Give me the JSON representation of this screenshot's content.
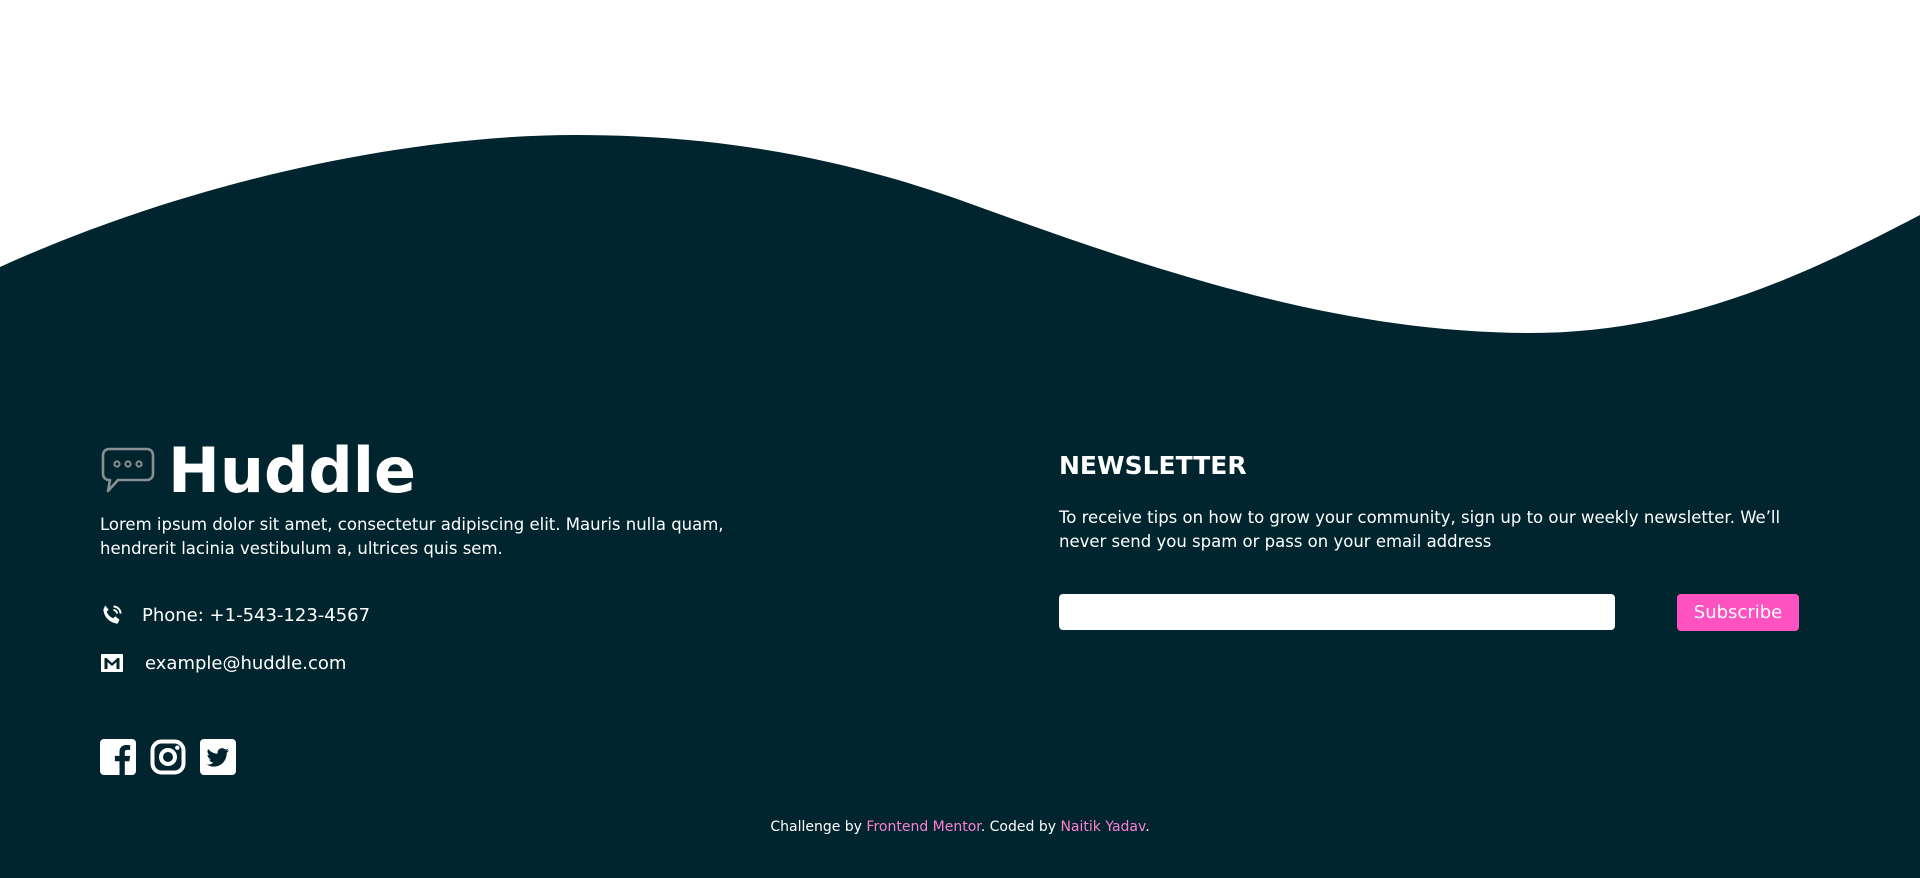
{
  "brand": {
    "name": "Huddle",
    "icon": "chat-bubble-icon"
  },
  "about": {
    "text": "Lorem ipsum dolor sit amet, consectetur adipiscing elit. Mauris nulla quam, hendrerit lacinia vestibulum a, ultrices quis sem."
  },
  "contact": {
    "phone": "Phone: +1-543-123-4567",
    "phone_icon": "phone-icon",
    "email": "example@huddle.com",
    "email_icon": "email-icon"
  },
  "social": [
    {
      "icon": "facebook-icon"
    },
    {
      "icon": "instagram-icon"
    },
    {
      "icon": "twitter-icon"
    }
  ],
  "newsletter": {
    "title": "NEWSLETTER",
    "text": "To receive tips on how to grow your community, sign up to our weekly newsletter. We’ll never send you spam or pass on your email address",
    "input_value": "",
    "button_label": "Subscribe"
  },
  "attribution": {
    "prefix": "Challenge by ",
    "link1": "Frontend Mentor",
    "middle": ". Coded by ",
    "link2": "Naitik Yadav",
    "suffix": "."
  },
  "colors": {
    "background": "#ffffff",
    "footer": "#00252e",
    "accent": "#ff52c1",
    "link": "#ff7fd1",
    "text": "#ffffff"
  }
}
